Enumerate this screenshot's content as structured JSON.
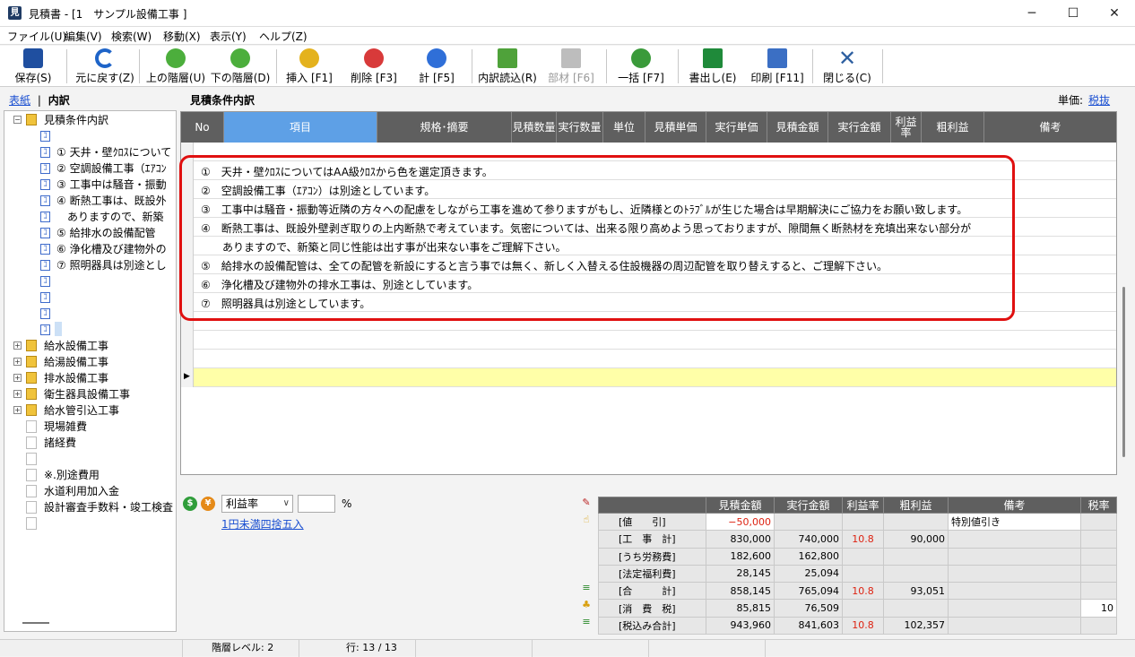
{
  "window": {
    "title": "見積書 - [1　サンプル設備工事 ]",
    "controls": {
      "minimize": "─",
      "maximize": "☐",
      "close": "✕"
    }
  },
  "menu": [
    "ファイル(U)",
    "編集(V)",
    "検索(W)",
    "移動(X)",
    "表示(Y)",
    "ヘルプ(Z)"
  ],
  "toolbar": [
    {
      "label": "保存(S)",
      "icon": "save-icon",
      "color": "#1f4fa0",
      "enabled": true
    },
    {
      "label": "元に戻す(Z)",
      "icon": "undo-icon",
      "color": "#1e64c8",
      "enabled": true
    },
    {
      "label": "上の階層(U)",
      "icon": "up-level-icon",
      "color": "#4cae3c",
      "enabled": true
    },
    {
      "label": "下の階層(D)",
      "icon": "down-level-icon",
      "color": "#4cae3c",
      "enabled": true
    },
    {
      "label": "挿入 [F1]",
      "icon": "insert-icon",
      "color": "#e4b21d",
      "enabled": true
    },
    {
      "label": "削除 [F3]",
      "icon": "delete-icon",
      "color": "#d83a3a",
      "enabled": true
    },
    {
      "label": "計 [F5]",
      "icon": "sum-icon",
      "color": "#2f6fd8",
      "enabled": true
    },
    {
      "label": "内訳読込(R)",
      "icon": "import-icon",
      "color": "#4fa23a",
      "enabled": true
    },
    {
      "label": "部材 [F6]",
      "icon": "parts-icon",
      "color": "#aaaaaa",
      "enabled": false
    },
    {
      "label": "一括 [F7]",
      "icon": "batch-icon",
      "color": "#3a9a3a",
      "enabled": true
    },
    {
      "label": "書出し(E)",
      "icon": "export-excel-icon",
      "color": "#1f8a3a",
      "enabled": true
    },
    {
      "label": "印刷 [F11]",
      "icon": "print-preview-icon",
      "color": "#3b6fc4",
      "enabled": true
    },
    {
      "label": "閉じる(C)",
      "icon": "close-icon",
      "color": "#2d5fa0",
      "enabled": true
    }
  ],
  "breadcrumb": {
    "link": "表紙",
    "sep": "|",
    "current": "内訳"
  },
  "tree": {
    "root": "見積条件内訳",
    "children": [
      "",
      "① 天井・壁ｸﾛｽについて",
      "② 空調設備工事（ｴｱｺﾝ",
      "③ 工事中は騒音・振動",
      "④ 断熱工事は、既設外",
      "　ありますので、新築",
      "⑤ 給排水の設備配管",
      "⑥ 浄化槽及び建物外の",
      "⑦ 照明器具は別途とし",
      "",
      "",
      "",
      ""
    ],
    "groups": [
      "給水設備工事",
      "給湯設備工事",
      "排水設備工事",
      "衛生器具設備工事",
      "給水管引込工事"
    ],
    "leaves": [
      "現場雑費",
      "諸経費",
      "",
      "※.別途費用",
      "水道利用加入金",
      "設計審査手数料・竣工検査",
      ""
    ]
  },
  "main": {
    "heading": "見積条件内訳",
    "unit_label": "単価:",
    "unit_value": "税抜",
    "columns": [
      "No",
      "項目",
      "規格･摘要",
      "見積数量",
      "実行数量",
      "単位",
      "見積単価",
      "実行単価",
      "見積金額",
      "実行金額",
      "利益率",
      "粗利益",
      "備考"
    ],
    "rows": [
      "",
      "①　天井・壁ｸﾛｽについてはAA級ｸﾛｽから色を選定頂きます。",
      "②　空調設備工事（ｴｱｺﾝ）は別途としています。",
      "③　工事中は騒音・振動等近隣の方々への配慮をしながら工事を進めて参りますがもし、近隣様とのﾄﾗﾌﾞﾙが生じた場合は早期解決にご協力をお願い致します。",
      "④　断熱工事は、既設外壁剥ぎ取りの上内断熱で考えています。気密については、出来る限り高めよう思っておりますが、隙間無く断熱材を充填出来ない部分が",
      "　　ありますので、新築と同じ性能は出す事が出来ない事をご理解下さい。",
      "⑤　給排水の設備配管は、全ての配管を新設にすると言う事では無く、新しく入替える住設機器の周辺配管を取り替えすると、ご理解下さい。",
      "⑥　浄化槽及び建物外の排水工事は、別途としています。",
      "⑦　照明器具は別途としています。",
      "",
      "",
      "",
      ""
    ]
  },
  "profit": {
    "mode": "利益率",
    "percent_value": "",
    "percent_sign": "%",
    "rounding_link": "1円未満四捨五入"
  },
  "summary": {
    "headers": [
      "",
      "見積金額",
      "実行金額",
      "利益率",
      "粗利益",
      "備考",
      "税率"
    ],
    "rows": [
      {
        "label": "[値　　引]",
        "est": "−50,000",
        "exe": "",
        "rate": "",
        "profit": "",
        "note": "特別値引き",
        "tax": ""
      },
      {
        "label": "[工　事　計]",
        "est": "830,000",
        "exe": "740,000",
        "rate": "10.8",
        "profit": "90,000",
        "note": "",
        "tax": ""
      },
      {
        "label": "[うち労務費]",
        "est": "182,600",
        "exe": "162,800",
        "rate": "",
        "profit": "",
        "note": "",
        "tax": ""
      },
      {
        "label": "[法定福利費]",
        "est": "28,145",
        "exe": "25,094",
        "rate": "",
        "profit": "",
        "note": "",
        "tax": ""
      },
      {
        "label": "[合　　　計]",
        "est": "858,145",
        "exe": "765,094",
        "rate": "10.8",
        "profit": "93,051",
        "note": "",
        "tax": ""
      },
      {
        "label": "[消　費　税]",
        "est": "85,815",
        "exe": "76,509",
        "rate": "",
        "profit": "",
        "note": "",
        "tax": "10"
      },
      {
        "label": "[税込み合計]",
        "est": "943,960",
        "exe": "841,603",
        "rate": "10.8",
        "profit": "102,357",
        "note": "",
        "tax": ""
      }
    ]
  },
  "status": {
    "level": "階層レベル:  2",
    "row": "行:  13 / 13"
  }
}
